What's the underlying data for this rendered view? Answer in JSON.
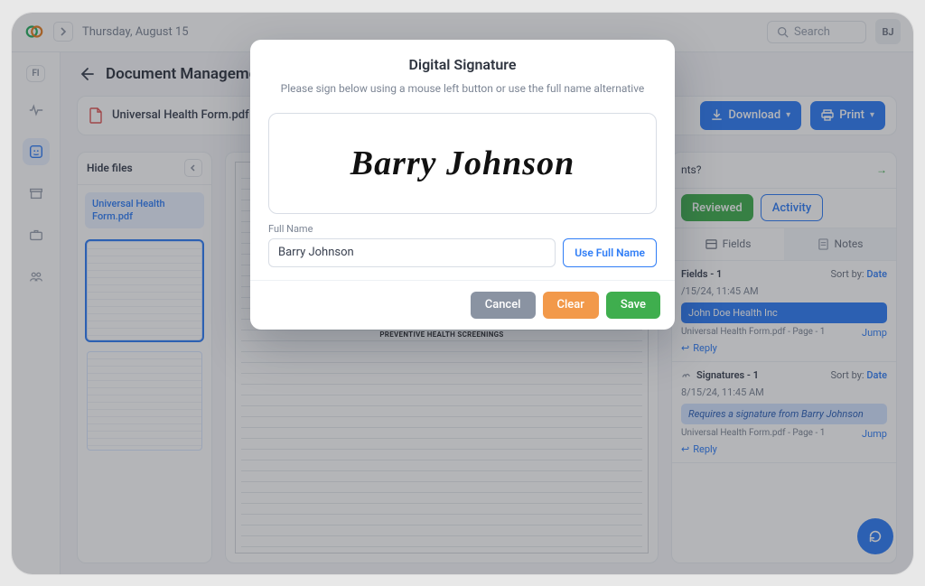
{
  "topbar": {
    "date": "Thursday, August 15",
    "search_placeholder": "Search",
    "avatar": "BJ"
  },
  "rail": {
    "pill": "FI"
  },
  "page_title": "Document Management",
  "doc": {
    "filename": "Universal Health Form.pdf",
    "download": "Download",
    "print": "Print"
  },
  "left": {
    "hide": "Hide files",
    "file": "Universal Health Form.pdf"
  },
  "center": {
    "screenings_title": "PREVENTIVE HEALTH SCREENINGS"
  },
  "right": {
    "updates": "nts?",
    "reviewed": "Reviewed",
    "activity": "Activity",
    "tab_fields": "Fields",
    "tab_notes": "Notes",
    "fields_header": "Fields - 1",
    "sort_label": "Sort by:",
    "sort_value": "Date",
    "ts1": "/15/24, 11:45 AM",
    "assignee": "John Doe Health Inc",
    "meta1": "Universal Health Form.pdf - Page - 1",
    "jump": "Jump",
    "reply": "Reply",
    "sig_header": "Signatures - 1",
    "ts2": "8/15/24, 11:45 AM",
    "sig_msg": "Requires a signature from Barry Johnson",
    "meta2": "Universal Health Form.pdf - Page - 1"
  },
  "modal": {
    "title": "Digital Signature",
    "instr": "Please sign below using a mouse left button or use the full name alternative",
    "signature": "Barry Johnson",
    "fullname_label": "Full Name",
    "fullname_value": "Barry Johnson",
    "use_fullname": "Use Full Name",
    "cancel": "Cancel",
    "clear": "Clear",
    "save": "Save"
  }
}
